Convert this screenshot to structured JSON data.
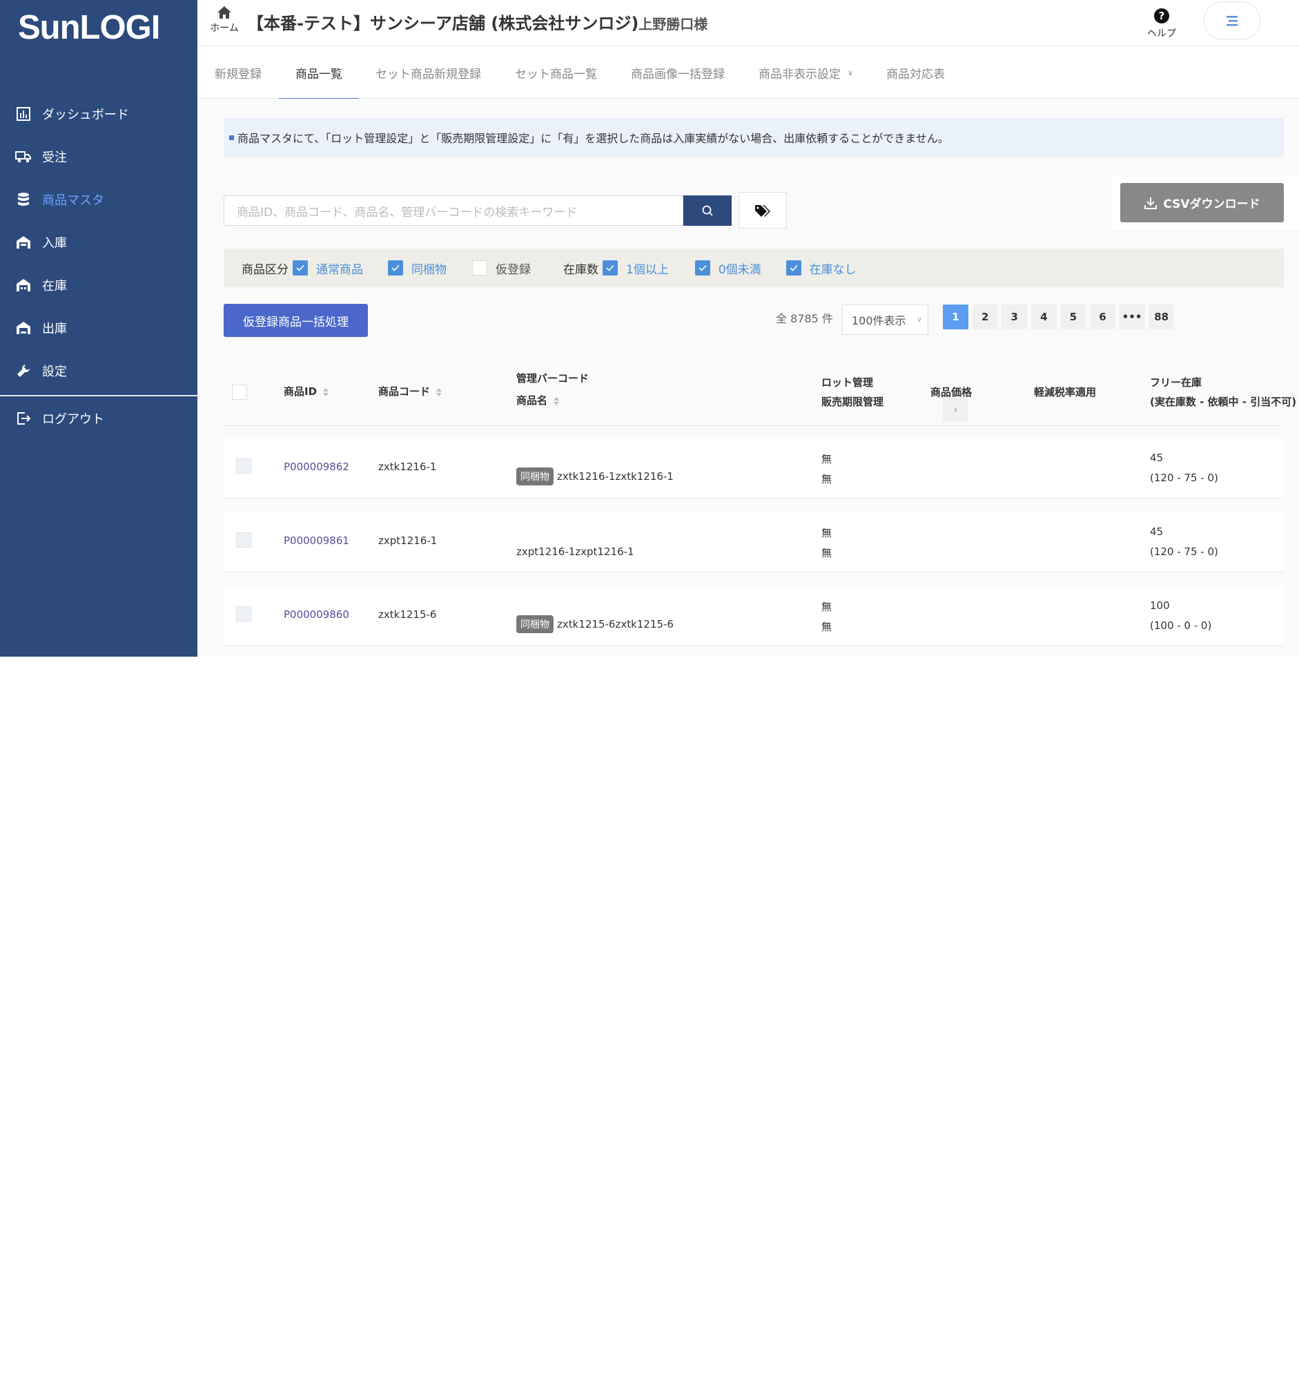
{
  "app": {
    "logo": "SunLOGI",
    "title": "【本番-テスト】サンシーア店舗 (株式会社サンロジ)",
    "title_suffix": "上野勝口様",
    "home_label": "ホーム",
    "help_label": "ヘルプ"
  },
  "sidebar": {
    "items": [
      {
        "label": "ダッシュボード",
        "icon": "chart-icon"
      },
      {
        "label": "受注",
        "icon": "truck-icon"
      },
      {
        "label": "商品マスタ",
        "icon": "database-icon",
        "active": true
      },
      {
        "label": "入庫",
        "icon": "warehouse-in-icon"
      },
      {
        "label": "在庫",
        "icon": "warehouse-icon"
      },
      {
        "label": "出庫",
        "icon": "warehouse-out-icon"
      },
      {
        "label": "設定",
        "icon": "wrench-icon"
      }
    ],
    "logout": "ログアウト"
  },
  "tabs": [
    {
      "label": "新規登録"
    },
    {
      "label": "商品一覧",
      "active": true
    },
    {
      "label": "セット商品新規登録"
    },
    {
      "label": "セット商品一覧"
    },
    {
      "label": "商品画像一括登録"
    },
    {
      "label": "商品非表示設定"
    },
    {
      "label": "商品対応表"
    }
  ],
  "notice": "商品マスタにて、「ロット管理設定」と「販売期限管理設定」に「有」を選択した商品は入庫実績がない場合、出庫依頼することができません。",
  "search": {
    "placeholder": "商品ID、商品コード、商品名、管理バーコードの検索キーワード"
  },
  "csv_label": "CSVダウンロード",
  "filters": {
    "category_label": "商品区分",
    "category_options": [
      {
        "label": "通常商品",
        "checked": true
      },
      {
        "label": "同梱物",
        "checked": true
      },
      {
        "label": "仮登録",
        "checked": false
      }
    ],
    "stock_label": "在庫数",
    "stock_options": [
      {
        "label": "1個以上",
        "checked": true
      },
      {
        "label": "0個未満",
        "checked": true
      },
      {
        "label": "在庫なし",
        "checked": true
      }
    ]
  },
  "bulk_label": "仮登録商品一括処理",
  "total": "全 8785 件",
  "per_page": "100件表示",
  "pagination": [
    "1",
    "2",
    "3",
    "4",
    "5",
    "6",
    "•••",
    "88"
  ],
  "table": {
    "headers": {
      "id": "商品ID",
      "code": "商品コード",
      "barcode": "管理バーコード",
      "name": "商品名",
      "lot": "ロット管理",
      "expiry": "販売期限管理",
      "price": "商品価格",
      "tax": "軽減税率適用",
      "free": "フリー在庫",
      "free_sub": "(実在庫数 - 依頼中 - 引当不可)"
    },
    "rows": [
      {
        "id": "P000009862",
        "code": "zxtk1216-1",
        "badge": "同梱物",
        "name": "zxtk1216-1zxtk1216-1",
        "lot": "無",
        "expiry": "無",
        "free": "45",
        "free_detail": "(120 - 75 - 0)"
      },
      {
        "id": "P000009861",
        "code": "zxpt1216-1",
        "badge": "",
        "name": "zxpt1216-1zxpt1216-1",
        "lot": "無",
        "expiry": "無",
        "free": "45",
        "free_detail": "(120 - 75 - 0)"
      },
      {
        "id": "P000009860",
        "code": "zxtk1215-6",
        "badge": "同梱物",
        "name": "zxtk1215-6zxtk1215-6",
        "lot": "無",
        "expiry": "無",
        "free": "100",
        "free_detail": "(100 - 0 - 0)"
      }
    ]
  },
  "colors": {
    "sidebar": "#2c4a7c",
    "accent": "#4b8fdb",
    "bulk_button": "#4a67c9",
    "csv_button": "#888888"
  }
}
